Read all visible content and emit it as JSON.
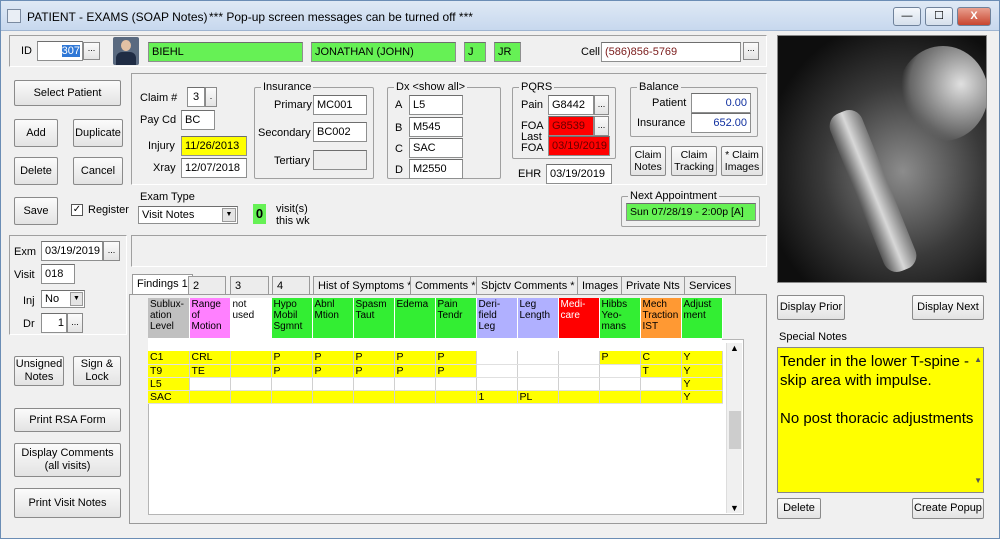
{
  "window": {
    "title": "PATIENT - EXAMS (SOAP Notes)",
    "message": "*** Pop-up screen messages can be turned off ***",
    "controls": [
      "—",
      "☐",
      "X"
    ]
  },
  "patient": {
    "id_label": "ID",
    "id": "307",
    "last": "BIEHL",
    "first": "JONATHAN  (JOHN)",
    "mi": "J",
    "suffix": "JR",
    "cell_label": "Cell",
    "cell": "(586)856-5769"
  },
  "left_buttons": {
    "select_patient": "Select Patient",
    "add": "Add",
    "duplicate": "Duplicate",
    "delete": "Delete",
    "cancel": "Cancel",
    "save": "Save",
    "register": "Register",
    "unsigned_notes": "Unsigned Notes",
    "sign_lock": "Sign & Lock",
    "print_rsa": "Print RSA Form",
    "display_comments": "Display Comments (all visits)",
    "print_visit_notes": "Print Visit Notes"
  },
  "claim": {
    "claim_label": "Claim #",
    "claim_no": "3",
    "paycd_label": "Pay Cd",
    "paycd": "BC",
    "injury_label": "Injury",
    "injury": "11/26/2013",
    "xray_label": "Xray",
    "xray": "12/07/2018"
  },
  "insurance": {
    "title": "Insurance",
    "primary_label": "Primary",
    "primary": "MC001",
    "secondary_label": "Secondary",
    "secondary": "BC002",
    "tertiary_label": "Tertiary",
    "tertiary": ""
  },
  "dx": {
    "title": "Dx <show all>",
    "rows": [
      {
        "k": "A",
        "v": "L5"
      },
      {
        "k": "B",
        "v": "M545"
      },
      {
        "k": "C",
        "v": "SAC"
      },
      {
        "k": "D",
        "v": "M2550"
      }
    ]
  },
  "pqrs": {
    "title": "PQRS",
    "pain_label": "Pain",
    "pain": "G8442",
    "foa_label": "FOA",
    "foa": "G8539",
    "last_foa_label": "Last FOA",
    "last_foa": "03/19/2019",
    "ehr_label": "EHR",
    "ehr": "03/19/2019"
  },
  "balance": {
    "title": "Balance",
    "patient_label": "Patient",
    "patient": "0.00",
    "insurance_label": "Insurance",
    "insurance": "652.00"
  },
  "claim_buttons": {
    "claim_notes": "Claim Notes",
    "claim_tracking": "Claim Tracking",
    "claim_images": "* Claim Images"
  },
  "exam": {
    "type_label": "Exam Type",
    "type": "Visit Notes",
    "visits": "0",
    "visits_label": "visit(s) this wk"
  },
  "next_appt": {
    "title": "Next Appointment",
    "value": "Sun 07/28/19 - 2:00p [A]"
  },
  "visit": {
    "exm_label": "Exm",
    "exm": "03/19/2019",
    "visit_label": "Visit",
    "visit": "018",
    "inj_label": "Inj",
    "inj": "No",
    "dr_label": "Dr",
    "dr": "1"
  },
  "tabs": [
    "Findings 1",
    "2",
    "3",
    "4",
    "Hist of Symptoms *",
    "Comments *",
    "Sbjctv Comments *",
    "Images",
    "Private Nts",
    "Services"
  ],
  "grid": {
    "headers": [
      "Sublux-ation Level",
      "Range of Motion",
      "not used",
      "Hypo Mobil Sgmnt",
      "Abnl Mtion",
      "Spasm Taut",
      "Edema",
      "Pain Tendr",
      "Deri-field Leg",
      "Leg Length",
      "Medi-care",
      "Hibbs Yeo-mans",
      "Mech Traction IST",
      "Adjust ment"
    ],
    "rows": [
      [
        "C1",
        "CRL",
        "",
        "P",
        "P",
        "P",
        "P",
        "P",
        "",
        "",
        "",
        "P",
        "C",
        "Y"
      ],
      [
        "T9",
        "TE",
        "",
        "P",
        "P",
        "P",
        "P",
        "P",
        "",
        "",
        "",
        "",
        "T",
        "Y"
      ],
      [
        "L5",
        "",
        "",
        "",
        "",
        "",
        "",
        "",
        "",
        "",
        "",
        "",
        "",
        "Y"
      ],
      [
        "SAC",
        "",
        "",
        "",
        "",
        "",
        "",
        "",
        "1",
        "PL",
        "",
        "",
        "",
        "Y"
      ]
    ]
  },
  "right": {
    "display_prior": "Display Prior",
    "display_next": "Display Next",
    "special_notes_label": "Special Notes",
    "special_notes_1": "Tender in the lower T-spine - skip area with impulse.",
    "special_notes_2": "No post thoracic adjustments",
    "delete": "Delete",
    "create_popup": "Create Popup"
  },
  "colors": {
    "green": "#66f155",
    "yellow": "#ffff00",
    "red": "#ff0000",
    "pink": "#ff80ff",
    "lavender": "#b0b0ff",
    "orange": "#ff9933",
    "grey": "#c0c0c0"
  }
}
